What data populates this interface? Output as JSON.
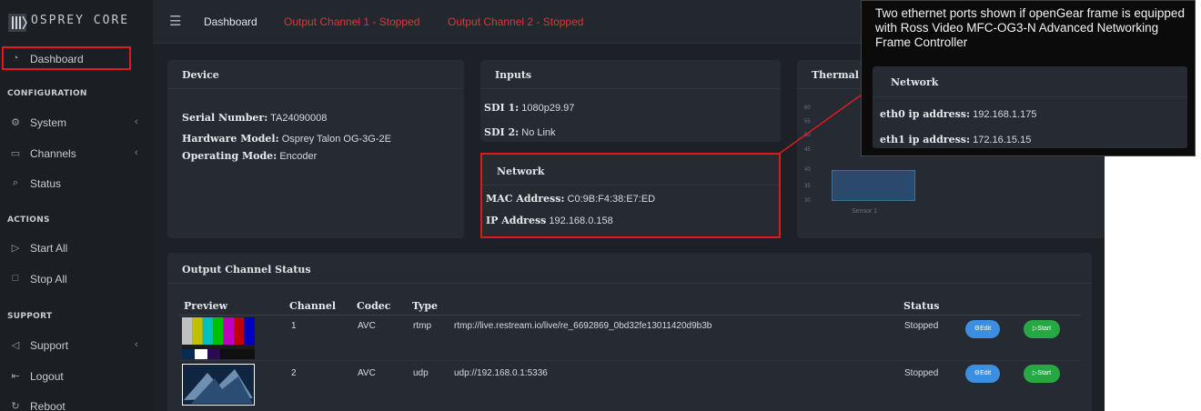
{
  "brand": {
    "name": "OSPREY CORE"
  },
  "topbar": {
    "menu_icon": "hamburger-icon",
    "dashboard": "Dashboard",
    "channel1_status": "Output Channel 1 - Stopped",
    "channel2_status": "Output Channel 2 - Stopped"
  },
  "sidebar": {
    "dashboard": {
      "label": "Dashboard",
      "icon": "gauge-icon"
    },
    "configuration_heading": "CONFIGURATION",
    "system": {
      "label": "System",
      "icon": "gear-icon"
    },
    "channels": {
      "label": "Channels",
      "icon": "video-icon"
    },
    "status": {
      "label": "Status",
      "icon": "search-icon"
    },
    "actions_heading": "ACTIONS",
    "start_all": {
      "label": "Start All",
      "icon": "play-icon"
    },
    "stop_all": {
      "label": "Stop All",
      "icon": "stop-icon"
    },
    "support_heading": "SUPPORT",
    "support": {
      "label": "Support",
      "icon": "send-icon"
    },
    "logout": {
      "label": "Logout",
      "icon": "logout-icon"
    },
    "reboot": {
      "label": "Reboot",
      "icon": "reboot-icon"
    }
  },
  "device": {
    "title": "Device",
    "serial_label": "Serial Number:",
    "serial_value": "TA24090008",
    "model_label": "Hardware Model:",
    "model_value": "Osprey Talon OG-3G-2E",
    "mode_label": "Operating Mode:",
    "mode_value": "Encoder"
  },
  "inputs": {
    "title": "Inputs",
    "sdi1_label": "SDI 1:",
    "sdi1_value": "1080p29.97",
    "sdi2_label": "SDI 2:",
    "sdi2_value": "No Link"
  },
  "network": {
    "title": "Network",
    "mac_label": "MAC Address:",
    "mac_value": "C0:9B:F4:38:E7:ED",
    "ip_label": "IP Address",
    "ip_value": "192.168.0.158"
  },
  "thermal": {
    "title": "Thermal",
    "y_ticks": [
      "60",
      "55",
      "50",
      "45",
      "40",
      "35",
      "30"
    ],
    "sensor_label": "Sensor 1",
    "bar_value": 40,
    "bar_color": "#2b4a6b"
  },
  "output_status": {
    "title": "Output Channel Status",
    "columns": {
      "preview": "Preview",
      "channel": "Channel",
      "codec": "Codec",
      "type": "Type",
      "status": "Status"
    },
    "rows": [
      {
        "channel": "1",
        "codec": "AVC",
        "type": "rtmp",
        "url": "rtmp://live.restream.io/live/re_6692869_0bd32fe13011420d9b3b",
        "status": "Stopped",
        "edit": "Edit",
        "start": "Start"
      },
      {
        "channel": "2",
        "codec": "AVC",
        "type": "udp",
        "url": "udp://192.168.0.1:5336",
        "status": "Stopped",
        "edit": "Edit",
        "start": "Start"
      }
    ]
  },
  "callout": {
    "text": "Two ethernet ports shown if openGear frame is equipped with Ross Video MFC-OG3-N Advanced Networking Frame Controller",
    "panel_title": "Network",
    "eth0_label": "eth0 ip address:",
    "eth0_value": "192.168.1.175",
    "eth1_label": "eth1 ip address:",
    "eth1_value": "172.16.15.15"
  },
  "colors": {
    "highlight": "#e0191f",
    "stopped": "#d9383a",
    "edit_button": "#3b8ee0",
    "start_button": "#28a745",
    "panel": "#262b33",
    "background": "#1d2127"
  }
}
